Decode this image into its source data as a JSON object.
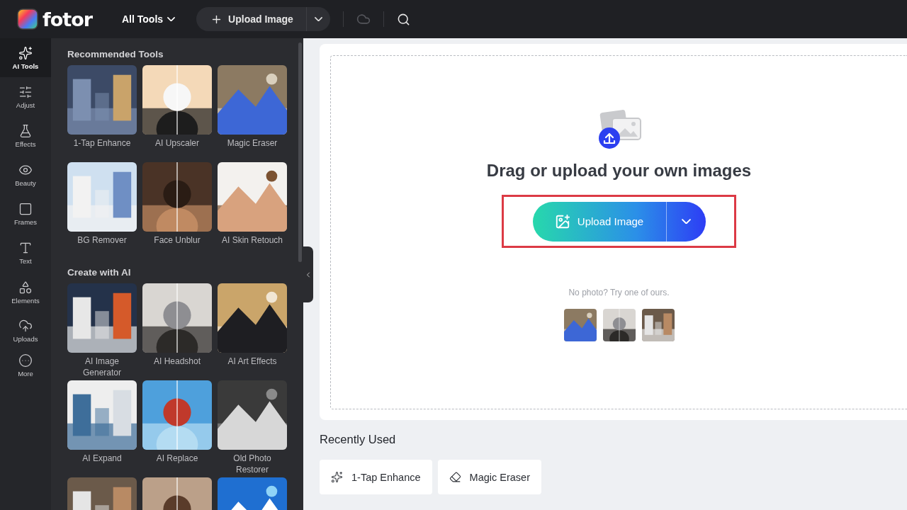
{
  "topbar": {
    "logo": "fotor",
    "all_tools": "All Tools",
    "upload_button": "Upload Image",
    "cloud_disabled": true
  },
  "rail": [
    {
      "label": "AI Tools",
      "selected": true
    },
    {
      "label": "Adjust",
      "selected": false
    },
    {
      "label": "Effects",
      "selected": false
    },
    {
      "label": "Beauty",
      "selected": false
    },
    {
      "label": "Frames",
      "selected": false
    },
    {
      "label": "Text",
      "selected": false
    },
    {
      "label": "Elements",
      "selected": false
    },
    {
      "label": "Uploads",
      "selected": false
    },
    {
      "label": "More",
      "selected": false
    }
  ],
  "sections": [
    {
      "title": "Recommended Tools",
      "tiles": [
        {
          "kind": "tool",
          "label": "1-Tap Enhance"
        },
        {
          "kind": "tool",
          "label": "AI Upscaler"
        },
        {
          "kind": "tool",
          "label": "Magic Eraser"
        },
        {
          "kind": "tool",
          "label": "BG Remover"
        },
        {
          "kind": "tool",
          "label": "Face Unblur"
        },
        {
          "kind": "tool",
          "label": "AI Skin Retouch"
        }
      ]
    },
    {
      "title": "Create with AI",
      "tiles": [
        {
          "kind": "tool",
          "label": "AI Image Generator"
        },
        {
          "kind": "tool",
          "label": "AI Headshot"
        },
        {
          "kind": "tool",
          "label": "AI Art Effects"
        },
        {
          "kind": "tool",
          "label": "AI Expand"
        },
        {
          "kind": "tool",
          "label": "AI Replace"
        },
        {
          "kind": "tool",
          "label": "Old Photo Restorer"
        },
        {
          "kind": "preview"
        },
        {
          "kind": "preview"
        },
        {
          "kind": "preview"
        }
      ]
    }
  ],
  "upload_area": {
    "heading": "Drag or upload your own images",
    "button": "Upload Image",
    "highlighted": true,
    "hint": "No photo? Try one of ours."
  },
  "recently_used": {
    "title": "Recently Used",
    "items": [
      "1-Tap Enhance",
      "Magic Eraser"
    ]
  }
}
